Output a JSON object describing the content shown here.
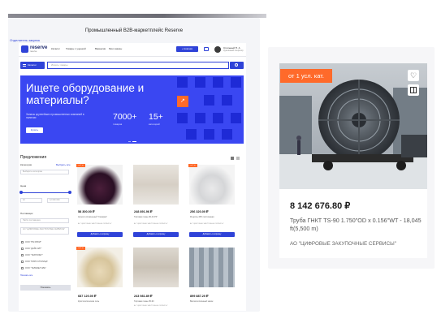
{
  "page": {
    "caption": "Промышленный B2B-маркетплейс Reserve",
    "top_link": "Отделатель закупок"
  },
  "header": {
    "logo": "reserve",
    "logo_sub": "reserve",
    "nav": [
      "Каталог",
      "Товары с уценкой",
      "Вакансии",
      "Мои заказы"
    ],
    "new_button": "+ Новинки",
    "user_name": "Стольный П. А",
    "user_sub": "Удалённый оператор"
  },
  "search": {
    "category_button": "Каталог",
    "placeholder": "Искать товары"
  },
  "hero": {
    "title": "Ищете оборудование и материалы?",
    "text": "Запасы крупнейших промышленных компаний в наличии",
    "button": "Купить",
    "stats": [
      {
        "value": "7000+",
        "label": "товаров"
      },
      {
        "value": "15+",
        "label": "категорий"
      }
    ]
  },
  "offers": {
    "title": "Предложения",
    "category_label": "Категория",
    "category_action": "Выбрать все",
    "category_placeholder": "Выберите категорию",
    "price_label": "Цена",
    "price_from": "10",
    "price_to": "12 000 000",
    "supplier_label": "Поставщик",
    "supplier_placeholder": "Найти поставщика",
    "supplier_selected": "АО \"ЦИФРОВЫЕ ЗАКУПОЧНЫЕ СЕРВИСЫ\"",
    "suppliers": [
      "ООО \"ПМ ЯНОЛ\"",
      "ООО \"ДАЙК ЭЛТ\"",
      "ООО \"ТЕХНОЛЕТ\"",
      "ООО \"НИРО СТОЛИЦА\"",
      "ООО \"ТЕЛЬФЕЛ ЭЛЕ\""
    ],
    "show_all": "Показать все",
    "show_button": "Показать"
  },
  "products": [
    {
      "badge": "от 1 кг",
      "price": "58 300.00 ₽",
      "desc": "Агрегат оплаченный \"Сахарин\"",
      "seller": "АО \"ЦИФРОВЫЕ ЗАКУПОЧНЫЕ СЕРВИСЫ\"",
      "button": "Добавить в корзину"
    },
    {
      "badge": "",
      "price": "248 891.96 ₽",
      "desc": "Торговая ткань 96-44 РР",
      "seller": "АО \"ЦИФРОВЫЕ ЗАКУПОЧНЫЕ СЕРВИСЫ\"",
      "button": "Добавить в корзину"
    },
    {
      "badge": "от 1 кг",
      "price": "256 320.00 ₽",
      "desc": "Рецсоль 45% постоянная",
      "seller": "АО \"ЦИФРОВЫЕ ЗАКУПОЧНЫЕ СЕРВИСЫ\"",
      "button": "Добавить в корзину"
    },
    {
      "badge": "от 1 кг",
      "price": "687 120.00 ₽",
      "desc": "Кристаллическая соль",
      "seller": "",
      "button": ""
    },
    {
      "badge": "",
      "price": "243 981.89 ₽",
      "desc": "Торговая ткань 95-93",
      "seller": "АО \"ЦИФРОВЫЕ ЗАКУПОЧНЫЕ СЕРВИСЫ\"",
      "button": ""
    },
    {
      "badge": "",
      "price": "899 887.20 ₽",
      "desc": "Вкопатеплиянный замок",
      "seller": "",
      "button": ""
    }
  ],
  "featured": {
    "badge": "от 1 усл. кат.",
    "price": "8 142 676.80 ₽",
    "title": "Труба ГНКТ TS-90 1.750\"OD x 0.156\"WT - 18,045 ft(5,500 m)",
    "seller": "АО \"ЦИФРОВЫЕ ЗАКУПОЧНЫЕ СЕРВИСЫ\""
  },
  "colors": {
    "brand": "#2f43d8",
    "hero": "#3a47f2",
    "accent": "#ff6a2a"
  }
}
